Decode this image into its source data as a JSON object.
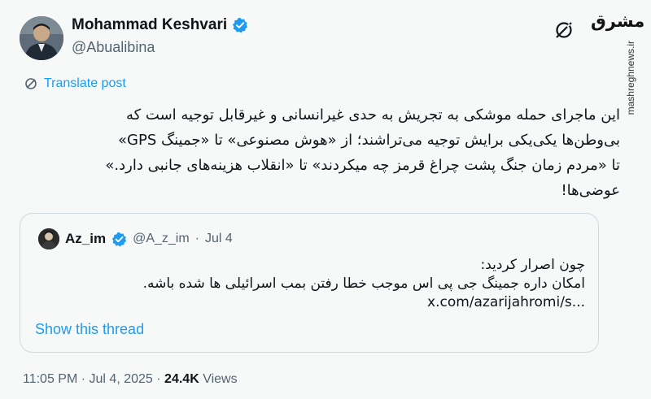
{
  "author": {
    "name": "Mohammad Keshvari",
    "handle": "@Abualibina"
  },
  "watermark": {
    "logo": "مشرق",
    "url": "mashreghnews.ir"
  },
  "translate_label": "Translate post",
  "body_lines": [
    "این ماجرای حمله موشکی به تجریش به حدی غیرانسانی و غیرقابل توجیه است که",
    "بی‌وطن‌ها یکی‌یکی برایش توجیه می‌تراشند؛ از «هوش مصنوعی» تا «جمینگ GPS»",
    "تا «مردم زمان جنگ پشت چراغ قرمز چه میکردند» تا «انقلاب هزینه‌های جانبی دارد.»",
    "عوضی‌ها!"
  ],
  "quote": {
    "name": "Az_im",
    "handle": "@A_z_im",
    "separator": "·",
    "date": "Jul 4",
    "lines": [
      "چون اصرار کردید:",
      "امکان داره جمینگ جی پی اس موجب خطا رفتن بمب اسرائیلی ها شده باشه."
    ],
    "link": "x.com/azarijahromi/s...",
    "show_thread": "Show this thread"
  },
  "meta": {
    "time": "11:05 PM",
    "separator": "·",
    "date": "Jul 4, 2025",
    "separator2": "·",
    "views_count": "24.4K",
    "views_label": "Views"
  },
  "colors": {
    "accent": "#1d9bf0",
    "muted": "#536471",
    "text": "#0f1419",
    "background": "#f7f9f9"
  },
  "icons": [
    "verified-badge-icon",
    "grok-icon",
    "translate-icon"
  ]
}
